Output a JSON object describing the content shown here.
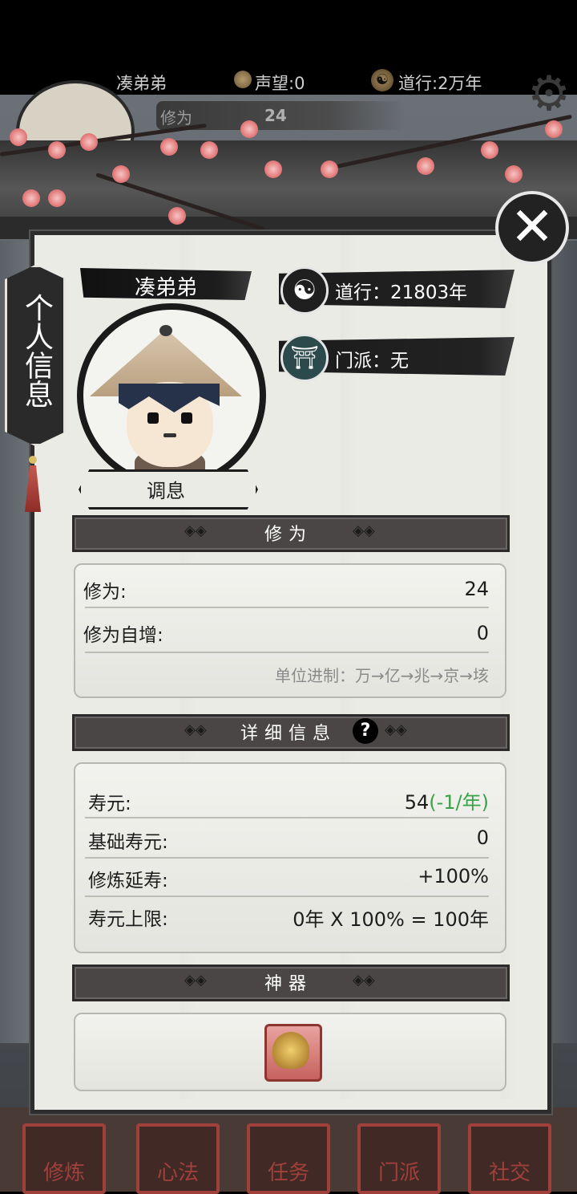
{
  "topbar": {
    "player_name": "凑弟弟",
    "reputation": "声望:0",
    "dao_practice": "道行:2万年",
    "cultivation_label": "修为",
    "cultivation_value": "24"
  },
  "side_tab": {
    "label": "个人信息"
  },
  "profile": {
    "name": "凑弟弟",
    "adjust_button": "调息",
    "dao_practice": "道行：21803年",
    "sect": "门派：无"
  },
  "sections": {
    "cultivation": {
      "title": "修为",
      "rows": [
        {
          "label": "修为:",
          "value": "24"
        },
        {
          "label": "修为自增:",
          "value": "0"
        }
      ],
      "units_hint": "单位进制：万→亿→兆→京→垓"
    },
    "details": {
      "title": "详细信息",
      "help": "?",
      "lifespan_label": "寿元:",
      "lifespan_value": "54",
      "lifespan_change": "(-1/年)",
      "rows": [
        {
          "label": "基础寿元:",
          "value": "0"
        },
        {
          "label": "修炼延寿:",
          "value": "+100%"
        },
        {
          "label": "寿元上限:",
          "value": "0年 X 100% = 100年"
        }
      ]
    },
    "artifact": {
      "title": "神器"
    }
  },
  "nav": [
    "修炼",
    "心法",
    "任务",
    "门派",
    "社交"
  ],
  "icons": {
    "close": "close-icon",
    "settings": "gear-icon",
    "dao": "taiji-icon",
    "sect": "temple-icon"
  },
  "colors": {
    "lifespan_change": "#39a248",
    "panel": "#ebebe6",
    "banner": "#1b1b1b"
  }
}
